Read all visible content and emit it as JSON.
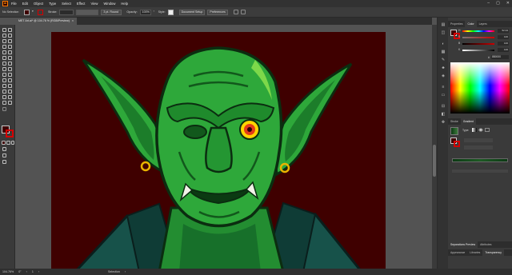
{
  "app": {
    "logo": "Ai"
  },
  "menu": [
    "File",
    "Edit",
    "Object",
    "Type",
    "Select",
    "Effect",
    "View",
    "Window",
    "Help"
  ],
  "control_bar": {
    "selection": "No Selection",
    "stroke_label": "Stroke:",
    "brush": "3 pt. Round",
    "opacity_label": "Opacity:",
    "opacity": "100%",
    "style_label": "Style:",
    "doc_setup": "Document Setup",
    "preferences": "Preferences"
  },
  "document_tab": {
    "title": "MET Art.ai* @ 104.76 % (RGB/Preview)",
    "close": "×"
  },
  "status_bar": {
    "zoom": "104.76%",
    "rotation": "0°",
    "page": "1",
    "tool": "Selection"
  },
  "panels": {
    "top_tabs": [
      "Properties",
      "Color",
      "Layers"
    ],
    "active_top_tab": "Color",
    "color_values": [
      "52.34",
      "100",
      "100",
      "100"
    ],
    "hex": "8B0000",
    "mid_tabs": [
      "Stroke",
      "Gradient"
    ],
    "active_mid_tab": "Gradient",
    "gradient_type_label": "Type:",
    "bottom_tabs_1": [
      "Separations Preview",
      "Attributes"
    ],
    "bottom_tabs_2": [
      "Appearance",
      "Libraries",
      "Transparency"
    ],
    "active_bottom_tab": "Transparency"
  },
  "colors": {
    "artboard_bg": "#3f0000",
    "goblin_green": "#2ea83a",
    "goblin_dark": "#0c4a16",
    "cloak": "#1a5b52",
    "eye": "#ffd400",
    "earring": "#e8b400"
  }
}
